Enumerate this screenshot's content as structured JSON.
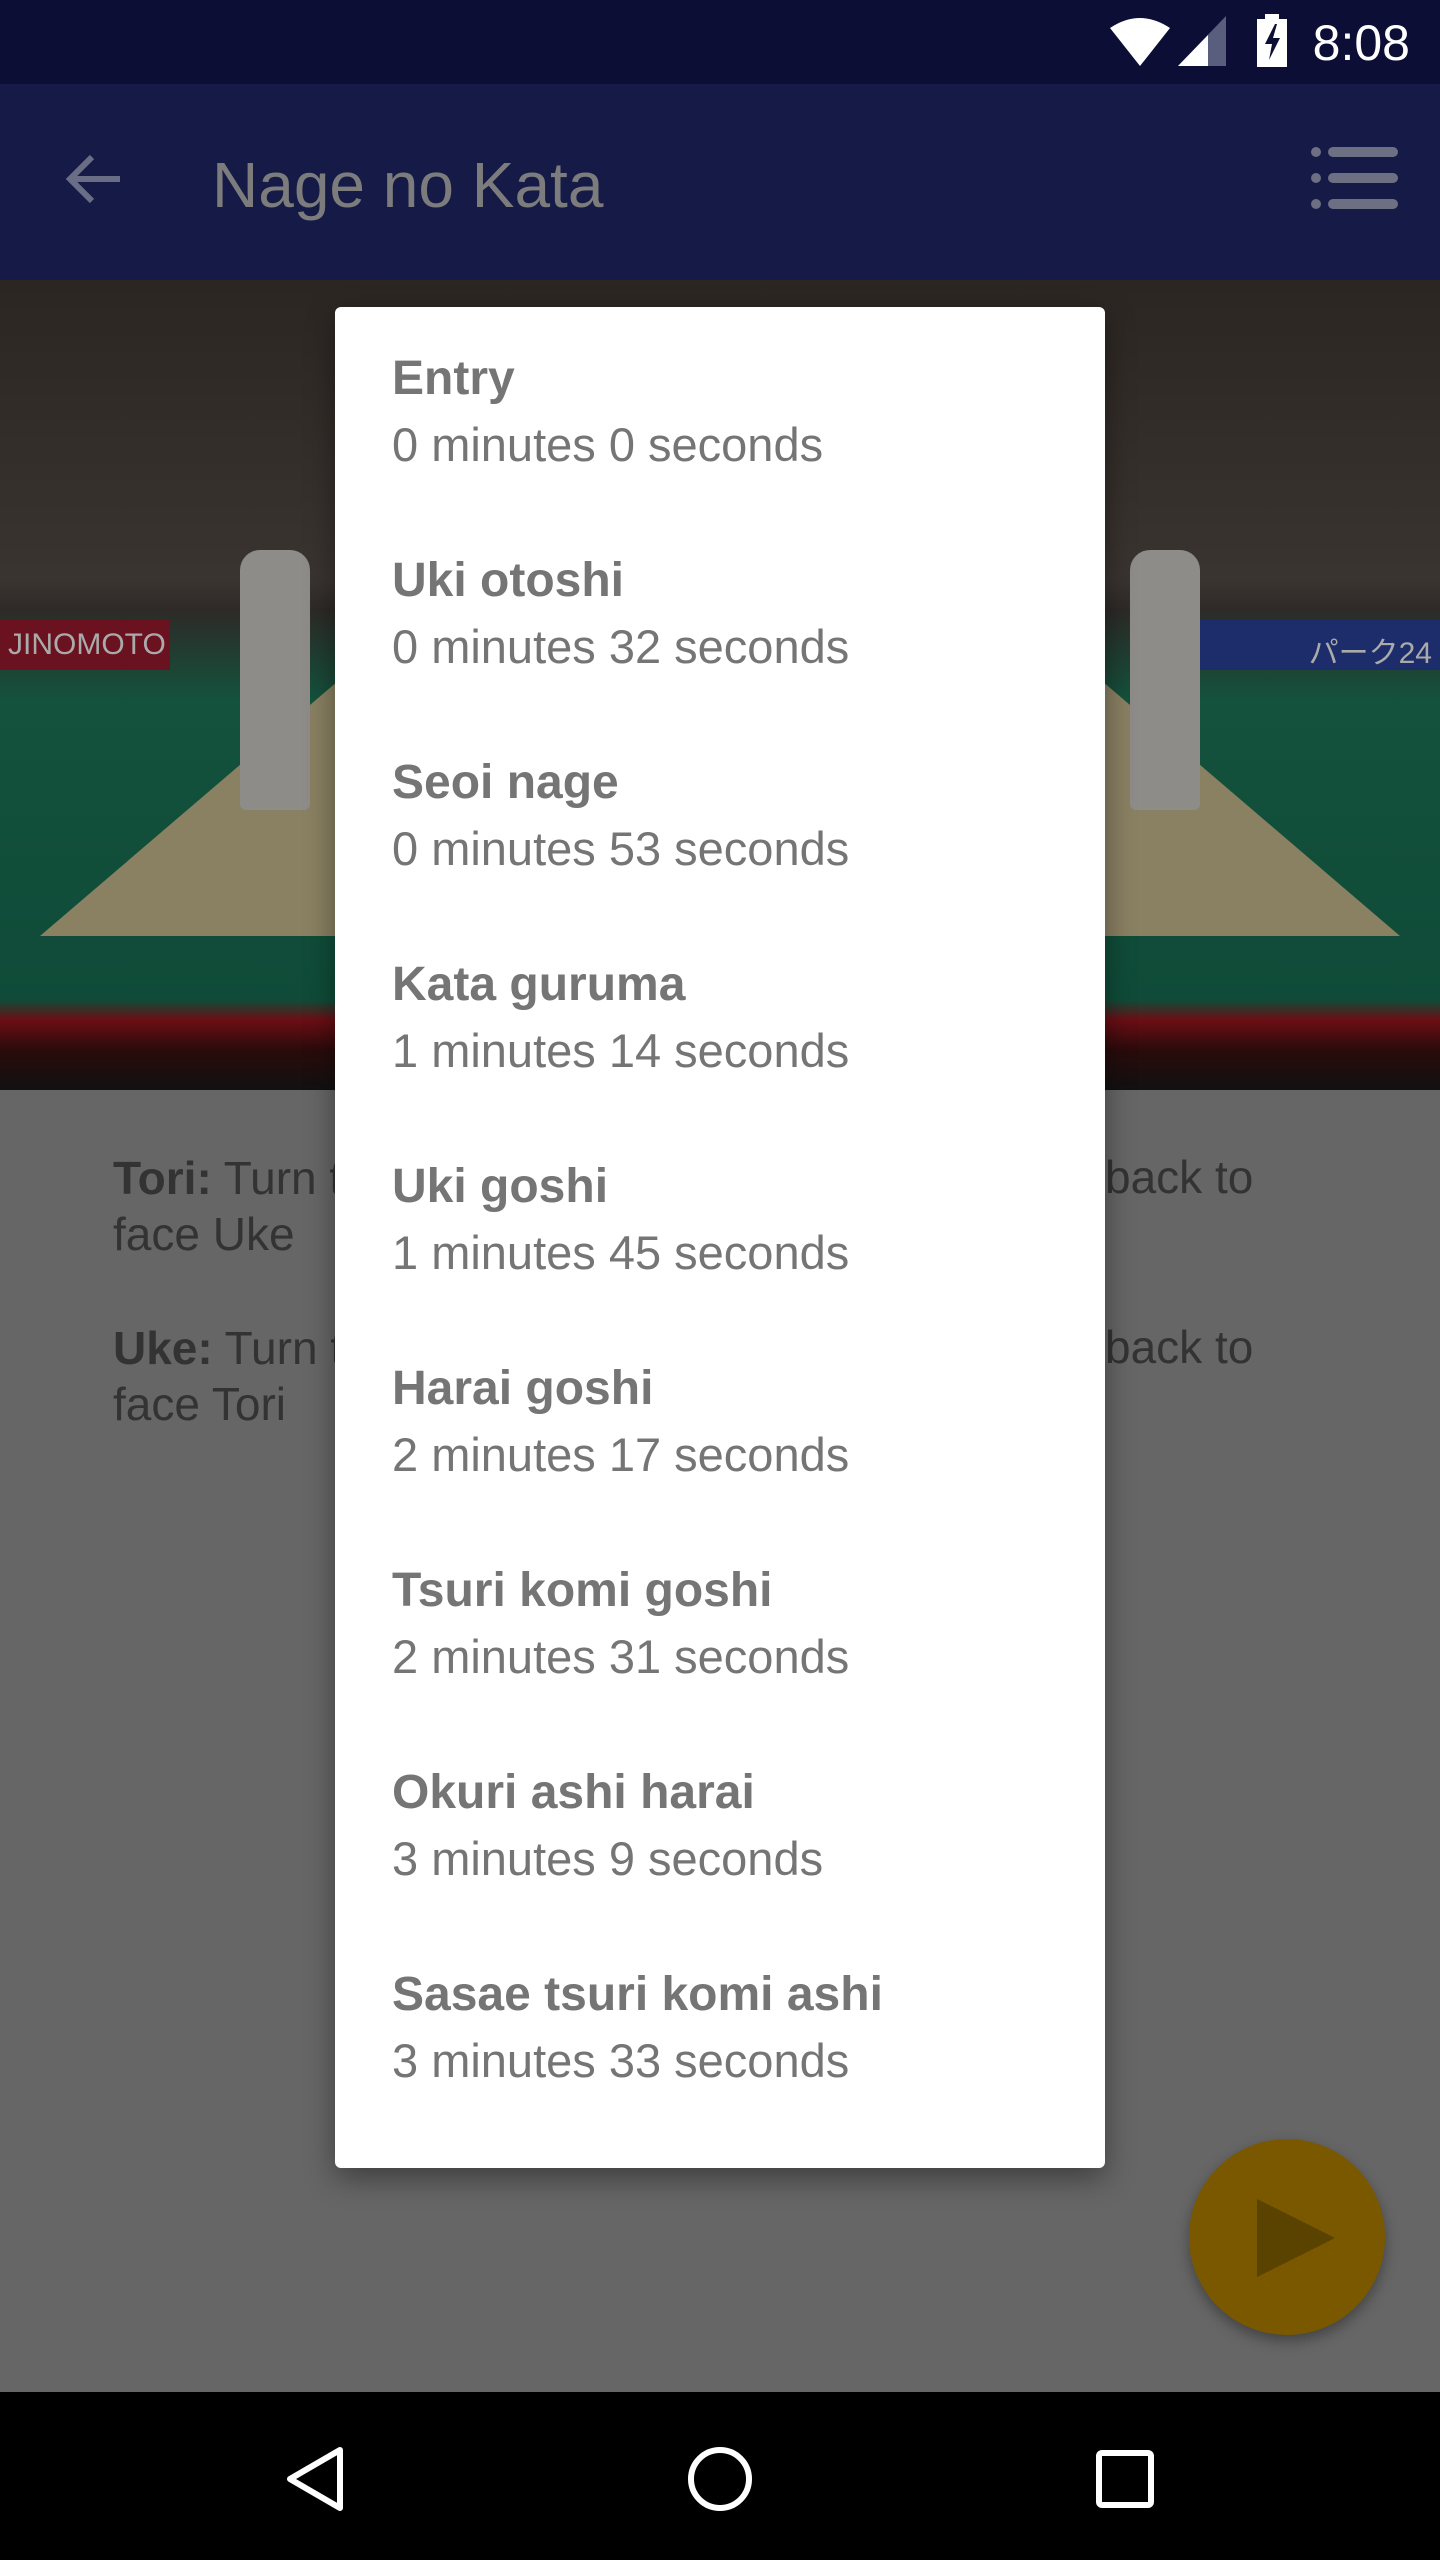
{
  "status_bar": {
    "time": "8:08",
    "icons": [
      "wifi-icon",
      "signal-icon",
      "battery-charging-icon"
    ]
  },
  "app_bar": {
    "title": "Nage no Kata",
    "back_icon": "arrow-left-icon",
    "menu_icon": "list-icon"
  },
  "video": {
    "banner_left": "JINOMOTO",
    "banner_right": "パーク24"
  },
  "content": {
    "tori": {
      "label": "Tori:",
      "left": " Turn t",
      "right": "back to",
      "line2": "face Uke"
    },
    "uke": {
      "label": "Uke:",
      "left": " Turn t",
      "right": "back to",
      "line2": "face Tori"
    }
  },
  "fab": {
    "icon": "play-icon",
    "color": "#7a5800"
  },
  "dialog": {
    "items": [
      {
        "title": "Entry",
        "time": "0 minutes 0 seconds"
      },
      {
        "title": "Uki otoshi",
        "time": "0 minutes 32 seconds"
      },
      {
        "title": "Seoi nage",
        "time": "0 minutes 53 seconds"
      },
      {
        "title": "Kata guruma",
        "time": "1 minutes 14 seconds"
      },
      {
        "title": "Uki goshi",
        "time": "1 minutes 45 seconds"
      },
      {
        "title": "Harai goshi",
        "time": "2 minutes 17 seconds"
      },
      {
        "title": "Tsuri komi goshi",
        "time": "2 minutes 31 seconds"
      },
      {
        "title": "Okuri ashi harai",
        "time": "3 minutes 9 seconds"
      },
      {
        "title": "Sasae tsuri komi ashi",
        "time": "3 minutes 33 seconds"
      }
    ]
  },
  "nav_bar": {
    "icons": [
      "back-triangle-icon",
      "home-circle-icon",
      "recents-square-icon"
    ]
  }
}
